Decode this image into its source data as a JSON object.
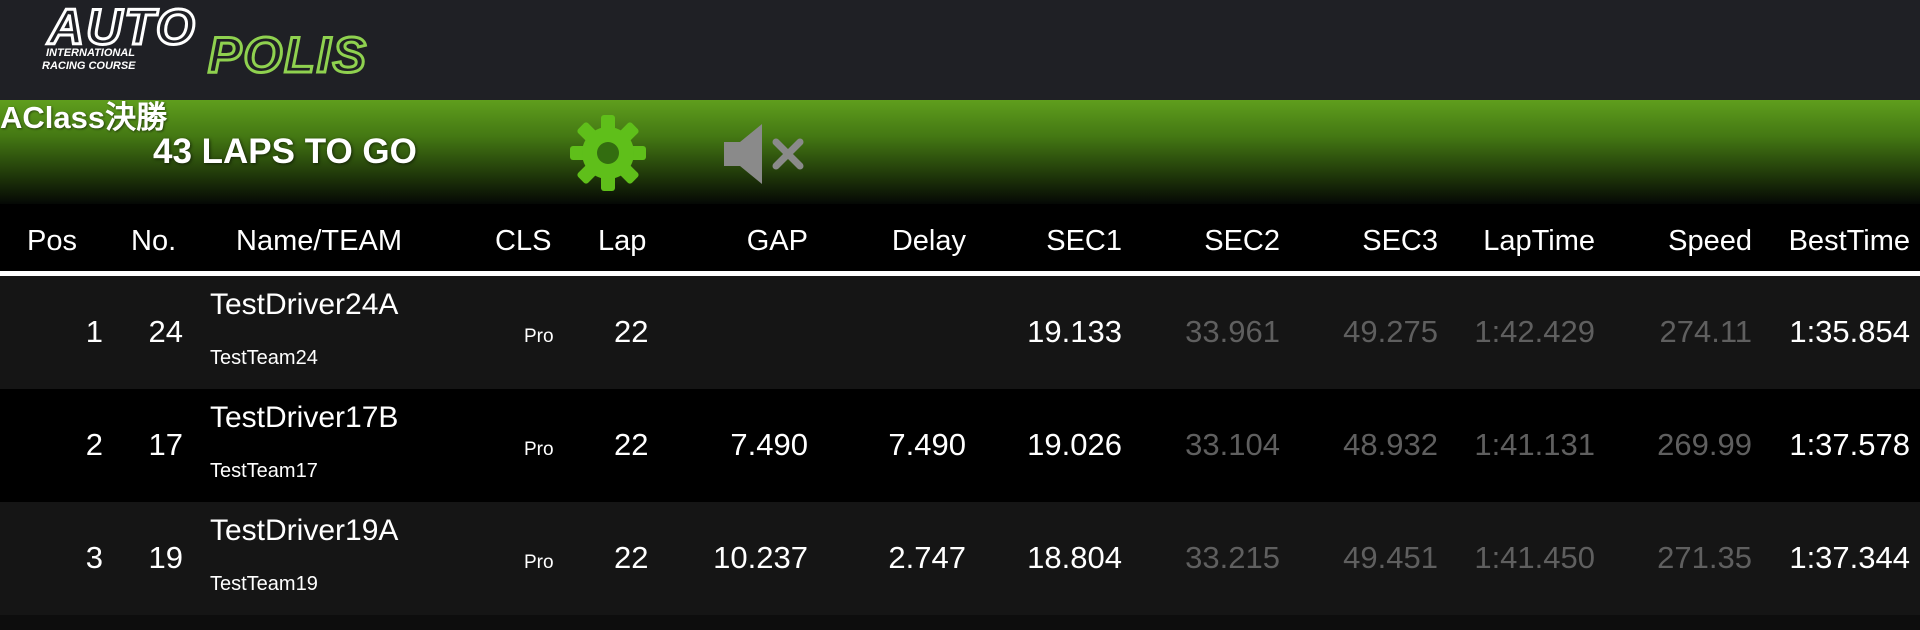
{
  "logo": {
    "line1": "AUTO",
    "line2": "POLIS",
    "sub1": "INTERNATIONAL",
    "sub2": "RACING COURSE"
  },
  "race": {
    "title": "AClass決勝",
    "laps_to_go": "43 LAPS TO GO",
    "settings_icon": "gear-icon",
    "sound_icon": "speaker-muted-icon"
  },
  "colors": {
    "accent_green": "#5fae1f",
    "muted_text": "#5f5f5f",
    "row_odd": "#151515",
    "row_even": "#000000"
  },
  "columns": {
    "pos": "Pos",
    "no": "No.",
    "name": "Name/TEAM",
    "cls": "CLS",
    "lap": "Lap",
    "gap": "GAP",
    "delay": "Delay",
    "sec1": "SEC1",
    "sec2": "SEC2",
    "sec3": "SEC3",
    "laptime": "LapTime",
    "speed": "Speed",
    "besttime": "BestTime"
  },
  "rows": [
    {
      "pos": "1",
      "no": "24",
      "driver": "TestDriver24A",
      "team": "TestTeam24",
      "cls": "Pro",
      "lap": "22",
      "gap": "",
      "delay": "",
      "sec1": "19.133",
      "sec2": "33.961",
      "sec3": "49.275",
      "laptime": "1:42.429",
      "speed": "274.11",
      "besttime": "1:35.854"
    },
    {
      "pos": "2",
      "no": "17",
      "driver": "TestDriver17B",
      "team": "TestTeam17",
      "cls": "Pro",
      "lap": "22",
      "gap": "7.490",
      "delay": "7.490",
      "sec1": "19.026",
      "sec2": "33.104",
      "sec3": "48.932",
      "laptime": "1:41.131",
      "speed": "269.99",
      "besttime": "1:37.578"
    },
    {
      "pos": "3",
      "no": "19",
      "driver": "TestDriver19A",
      "team": "TestTeam19",
      "cls": "Pro",
      "lap": "22",
      "gap": "10.237",
      "delay": "2.747",
      "sec1": "18.804",
      "sec2": "33.215",
      "sec3": "49.451",
      "laptime": "1:41.450",
      "speed": "271.35",
      "besttime": "1:37.344"
    }
  ]
}
